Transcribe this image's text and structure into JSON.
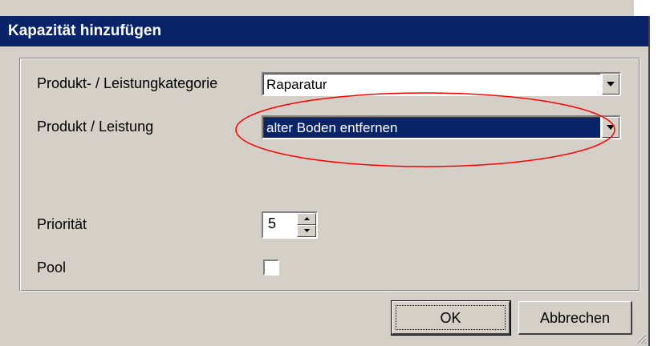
{
  "dialog": {
    "title": "Kapazität hinzufügen"
  },
  "form": {
    "category_label": "Produkt- / Leistungkategorie",
    "category_value": "Raparatur",
    "product_label": "Produkt / Leistung",
    "product_value": "alter Boden entfernen",
    "priority_label": "Priorität",
    "priority_value": "5",
    "pool_label": "Pool",
    "pool_checked": false
  },
  "buttons": {
    "ok_label": "OK",
    "cancel_label": "Abbrechen"
  },
  "icons": {
    "dropdown": "chevron-down-icon",
    "spin_up": "arrow-up-icon",
    "spin_down": "arrow-down-icon",
    "resize_grip": "resize-grip-icon"
  },
  "colors": {
    "titlebar": "#0a246a",
    "window": "#d4d0c8",
    "selection": "#0a246a",
    "annotation": "#ff0000"
  }
}
